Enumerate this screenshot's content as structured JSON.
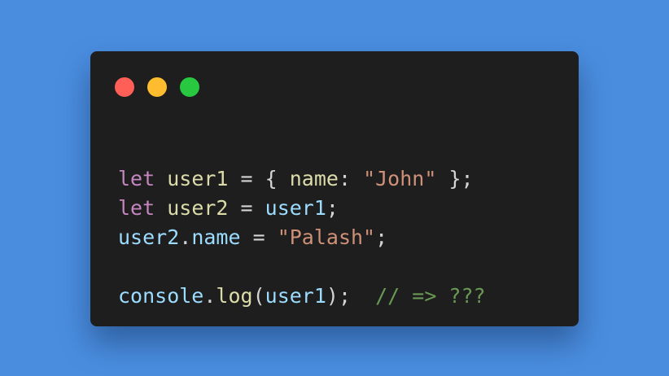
{
  "colors": {
    "background": "#4a8ddf",
    "window": "#1e1e1e",
    "close": "#ff5f57",
    "minimize": "#febc2e",
    "maximize": "#28c840"
  },
  "window_controls": [
    {
      "name": "close",
      "color": "#ff5f57"
    },
    {
      "name": "minimize",
      "color": "#febc2e"
    },
    {
      "name": "maximize",
      "color": "#28c840"
    }
  ],
  "code_lines": [
    [
      {
        "type": "keyword",
        "text": "let"
      },
      {
        "type": "punct",
        "text": " "
      },
      {
        "type": "var-decl",
        "text": "user1"
      },
      {
        "type": "punct",
        "text": " = { "
      },
      {
        "type": "prop-decl",
        "text": "name"
      },
      {
        "type": "punct",
        "text": ": "
      },
      {
        "type": "string",
        "text": "\"John\""
      },
      {
        "type": "punct",
        "text": " };"
      }
    ],
    [
      {
        "type": "keyword",
        "text": "let"
      },
      {
        "type": "punct",
        "text": " "
      },
      {
        "type": "var-decl",
        "text": "user2"
      },
      {
        "type": "punct",
        "text": " = "
      },
      {
        "type": "var",
        "text": "user1"
      },
      {
        "type": "punct",
        "text": ";"
      }
    ],
    [
      {
        "type": "var",
        "text": "user2"
      },
      {
        "type": "punct",
        "text": "."
      },
      {
        "type": "prop",
        "text": "name"
      },
      {
        "type": "punct",
        "text": " = "
      },
      {
        "type": "string",
        "text": "\"Palash\""
      },
      {
        "type": "punct",
        "text": ";"
      }
    ],
    [],
    [
      {
        "type": "var",
        "text": "console"
      },
      {
        "type": "punct",
        "text": "."
      },
      {
        "type": "method",
        "text": "log"
      },
      {
        "type": "punct",
        "text": "("
      },
      {
        "type": "var",
        "text": "user1"
      },
      {
        "type": "punct",
        "text": ");  "
      },
      {
        "type": "comment",
        "text": "// => ???"
      }
    ]
  ]
}
